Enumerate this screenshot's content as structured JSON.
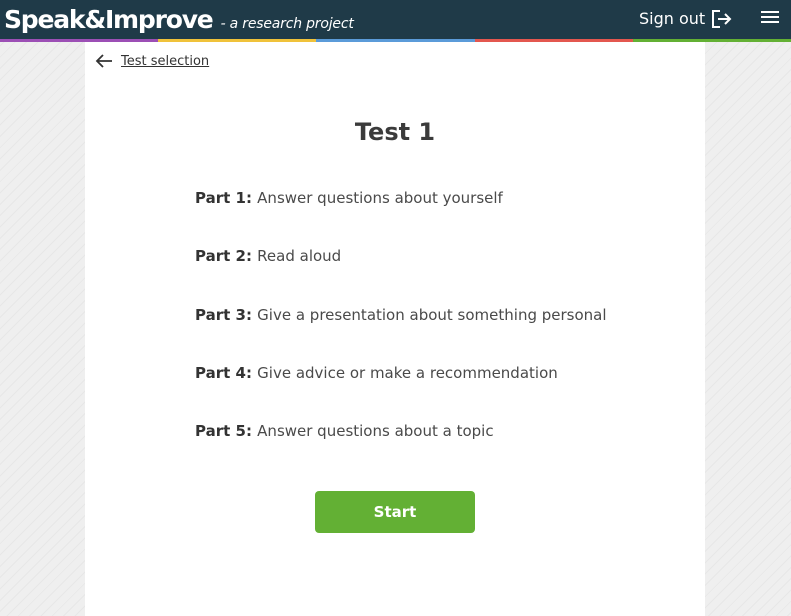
{
  "header": {
    "brand": "Speak&Improve",
    "tagline": "- a research project",
    "signout_label": "Sign out",
    "signout_icon": "sign-out-icon",
    "menu_icon": "hamburger-menu-icon",
    "background_color": "#1f3a48"
  },
  "color_stripe": [
    "#9c4fb5",
    "#f0c23a",
    "#5b9bd9",
    "#e3574f",
    "#63b034"
  ],
  "nav": {
    "back_icon": "arrow-left-icon",
    "back_label": "Test selection"
  },
  "test": {
    "title": "Test 1",
    "parts": [
      {
        "label": "Part 1:",
        "text": "Answer questions about yourself"
      },
      {
        "label": "Part 2:",
        "text": "Read aloud"
      },
      {
        "label": "Part 3:",
        "text": "Give a presentation about something personal"
      },
      {
        "label": "Part 4:",
        "text": "Give advice or make a recommendation"
      },
      {
        "label": "Part 5:",
        "text": "Answer questions about a topic"
      }
    ],
    "start_label": "Start",
    "start_color": "#63b034"
  }
}
